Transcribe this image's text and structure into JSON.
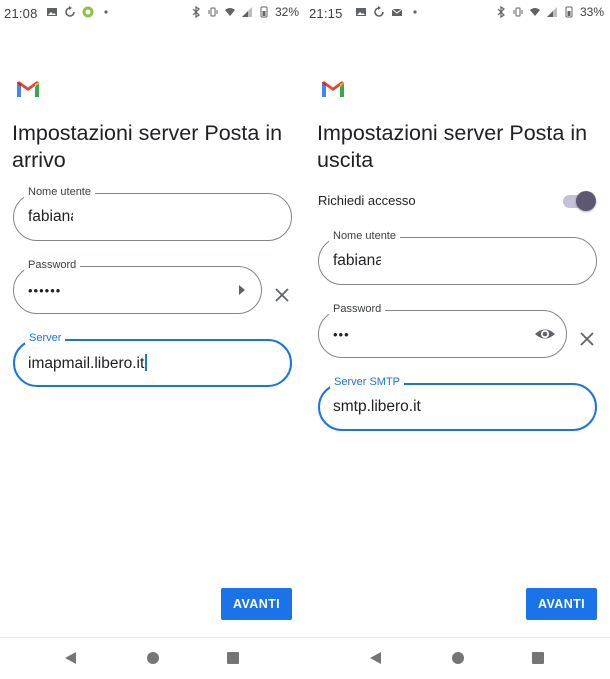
{
  "left": {
    "status": {
      "time": "21:08",
      "battery": "32%"
    },
    "title": "Impostazioni server Posta in arrivo",
    "username": {
      "label": "Nome utente",
      "value": "fabiana"
    },
    "password": {
      "label": "Password",
      "value": "••••••"
    },
    "server": {
      "label": "Server",
      "value": "imapmail.libero.it"
    },
    "next_label": "AVANTI"
  },
  "right": {
    "status": {
      "time": "21:15",
      "battery": "33%"
    },
    "title": "Impostazioni server Posta in uscita",
    "require_access": {
      "label": "Richiedi accesso",
      "checked": true
    },
    "username": {
      "label": "Nome utente",
      "value": "fabiana"
    },
    "password": {
      "label": "Password",
      "value": "•••"
    },
    "server": {
      "label": "Server SMTP",
      "value": "smtp.libero.it"
    },
    "next_label": "AVANTI"
  },
  "icons": {
    "logo": "gmail-logo-icon",
    "clear": "close-icon",
    "reveal": "eye-icon",
    "nav": [
      "back-triangle-icon",
      "home-circle-icon",
      "recents-square-icon"
    ]
  },
  "colors": {
    "accent": "#1a73e8",
    "toggle_knob": "#5f5670",
    "toggle_track": "#c5c1d6"
  }
}
